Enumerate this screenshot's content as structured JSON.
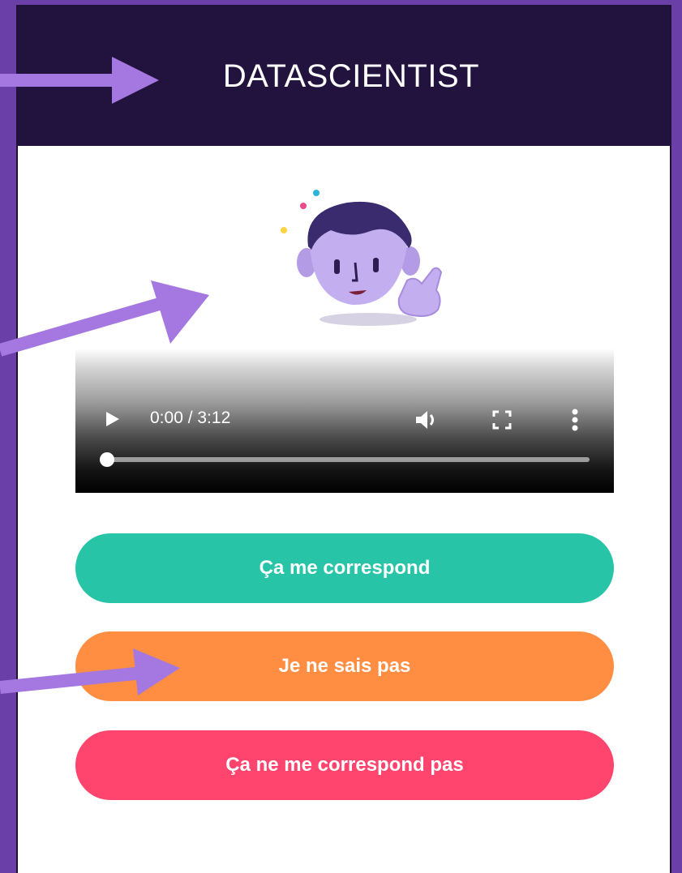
{
  "header": {
    "title": "DATASCIENTIST"
  },
  "illustration": {
    "icon": "character-pointing-icon"
  },
  "video": {
    "time": "0:00 / 3:12",
    "progress": 0.0,
    "play_icon": "play-icon",
    "volume_icon": "volume-icon",
    "fullscreen_icon": "fullscreen-icon",
    "more_icon": "more-options-icon"
  },
  "buttons": {
    "match": {
      "label": "Ça me correspond",
      "color": "#27c4a8"
    },
    "unsure": {
      "label": "Je ne sais pas",
      "color": "#ff8e42"
    },
    "no_match": {
      "label": "Ça ne me correspond pas",
      "color": "#ff456d"
    }
  },
  "colors": {
    "background": "#6a3fa8",
    "header": "#22133e",
    "arrow": "#a478e0"
  }
}
